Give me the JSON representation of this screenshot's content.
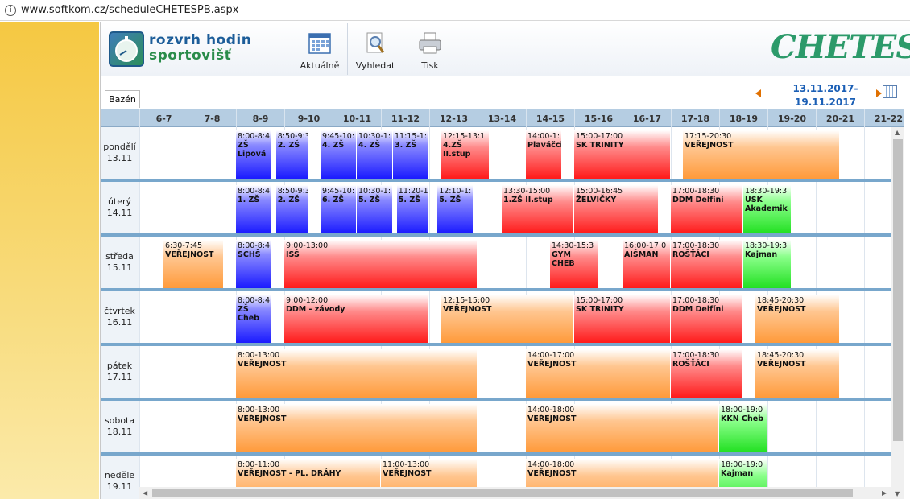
{
  "browser": {
    "url": "www.softkom.cz/scheduleCHETESPB.aspx"
  },
  "header": {
    "logo_line1": "rozvrh hodin",
    "logo_line2": "sportovišť",
    "tools": [
      {
        "label": "Aktuálně",
        "icon": "calendar-grid-icon"
      },
      {
        "label": "Vyhledat",
        "icon": "magnifier-icon"
      },
      {
        "label": "Tisk",
        "icon": "printer-icon"
      }
    ],
    "brand": "CHETES"
  },
  "tabs": [
    {
      "label": "Bazén",
      "active": true
    }
  ],
  "date_range": {
    "line1": "13.11.2017-",
    "line2": "19.11.2017"
  },
  "hours": [
    "6-7",
    "7-8",
    "8-9",
    "9-10",
    "10-11",
    "11-12",
    "12-13",
    "13-14",
    "14-15",
    "15-16",
    "16-17",
    "17-18",
    "18-19",
    "19-20",
    "20-21",
    "21-22"
  ],
  "days": [
    {
      "name": "pondělí",
      "date": "13.11",
      "events": [
        {
          "start": 8,
          "end": 8.75,
          "time": "8:00-8:4",
          "label": "ZŠ Lipová",
          "color": "blue"
        },
        {
          "start": 8.83,
          "end": 9.5,
          "time": "8:50-9:3",
          "label": "2. ZŠ",
          "color": "blue"
        },
        {
          "start": 9.75,
          "end": 10.5,
          "time": "9:45-10:",
          "label": "4. ZŠ",
          "color": "blue"
        },
        {
          "start": 10.5,
          "end": 11.25,
          "time": "10:30-1:",
          "label": "4. ZŠ",
          "color": "blue"
        },
        {
          "start": 11.25,
          "end": 12,
          "time": "11:15-1:",
          "label": "3. ZŠ",
          "color": "blue"
        },
        {
          "start": 12.25,
          "end": 13.25,
          "time": "12:15-13:1",
          "label": "4.ZŠ II.stup",
          "color": "red"
        },
        {
          "start": 14,
          "end": 14.75,
          "time": "14:00-1:",
          "label": "Plaváčci",
          "color": "red"
        },
        {
          "start": 15,
          "end": 17,
          "time": "15:00-17:00",
          "label": "SK TRINITY",
          "color": "red"
        },
        {
          "start": 17.25,
          "end": 20.5,
          "time": "17:15-20:30",
          "label": "VEŘEJNOST",
          "color": "orange"
        }
      ]
    },
    {
      "name": "úterý",
      "date": "14.11",
      "events": [
        {
          "start": 8,
          "end": 8.75,
          "time": "8:00-8:4",
          "label": "1. ZŠ",
          "color": "blue"
        },
        {
          "start": 8.83,
          "end": 9.5,
          "time": "8:50-9:3",
          "label": "2. ZŠ",
          "color": "blue"
        },
        {
          "start": 9.75,
          "end": 10.5,
          "time": "9:45-10:",
          "label": "6. ZŠ",
          "color": "blue"
        },
        {
          "start": 10.5,
          "end": 11.25,
          "time": "10:30-1:",
          "label": "5. ZŠ",
          "color": "blue"
        },
        {
          "start": 11.33,
          "end": 12,
          "time": "11:20-1:",
          "label": "5. ZŠ",
          "color": "blue"
        },
        {
          "start": 12.17,
          "end": 12.92,
          "time": "12:10-1:",
          "label": "5. ZŠ",
          "color": "blue"
        },
        {
          "start": 13.5,
          "end": 15,
          "time": "13:30-15:00",
          "label": "1.ZŠ II.stup",
          "color": "red"
        },
        {
          "start": 15,
          "end": 16.75,
          "time": "15:00-16:45",
          "label": "ŽELVIČKY",
          "color": "red"
        },
        {
          "start": 17,
          "end": 18.5,
          "time": "17:00-18:30",
          "label": "DDM Delfíni",
          "color": "red"
        },
        {
          "start": 18.5,
          "end": 19.5,
          "time": "18:30-19:3",
          "label": "USK Akademik",
          "color": "green"
        }
      ]
    },
    {
      "name": "středa",
      "date": "15.11",
      "events": [
        {
          "start": 6.5,
          "end": 7.75,
          "time": "6:30-7:45",
          "label": "VEŘEJNOST",
          "color": "orange"
        },
        {
          "start": 8,
          "end": 8.75,
          "time": "8:00-8:4",
          "label": "SCHŠ",
          "color": "blue"
        },
        {
          "start": 9,
          "end": 13,
          "time": "9:00-13:00",
          "label": "ISŠ",
          "color": "red"
        },
        {
          "start": 14.5,
          "end": 15.5,
          "time": "14:30-15:3",
          "label": "GYM CHEB",
          "color": "red"
        },
        {
          "start": 16,
          "end": 17,
          "time": "16:00-17:0",
          "label": "AIŠMAN",
          "color": "red"
        },
        {
          "start": 17,
          "end": 18.5,
          "time": "17:00-18:30",
          "label": "ROŠŤÁCI",
          "color": "red"
        },
        {
          "start": 18.5,
          "end": 19.5,
          "time": "18:30-19:3",
          "label": "Kajman",
          "color": "green"
        }
      ]
    },
    {
      "name": "čtvrtek",
      "date": "16.11",
      "events": [
        {
          "start": 8,
          "end": 8.75,
          "time": "8:00-8:4",
          "label": "ZŠ Cheb",
          "color": "blue"
        },
        {
          "start": 9,
          "end": 12,
          "time": "9:00-12:00",
          "label": "DDM - závody",
          "color": "red"
        },
        {
          "start": 12.25,
          "end": 15,
          "time": "12:15-15:00",
          "label": "VEŘEJNOST",
          "color": "orange"
        },
        {
          "start": 15,
          "end": 17,
          "time": "15:00-17:00",
          "label": "SK TRINITY",
          "color": "red"
        },
        {
          "start": 17,
          "end": 18.5,
          "time": "17:00-18:30",
          "label": "DDM Delfíni",
          "color": "red"
        },
        {
          "start": 18.75,
          "end": 20.5,
          "time": "18:45-20:30",
          "label": "VEŘEJNOST",
          "color": "orange"
        }
      ]
    },
    {
      "name": "pátek",
      "date": "17.11",
      "events": [
        {
          "start": 8,
          "end": 13,
          "time": "8:00-13:00",
          "label": "VEŘEJNOST",
          "color": "orange"
        },
        {
          "start": 14,
          "end": 17,
          "time": "14:00-17:00",
          "label": "VEŘEJNOST",
          "color": "orange"
        },
        {
          "start": 17,
          "end": 18.5,
          "time": "17:00-18:30",
          "label": "ROŠŤÁCI",
          "color": "red"
        },
        {
          "start": 18.75,
          "end": 20.5,
          "time": "18:45-20:30",
          "label": "VEŘEJNOST",
          "color": "orange"
        }
      ]
    },
    {
      "name": "sobota",
      "date": "18.11",
      "events": [
        {
          "start": 8,
          "end": 13,
          "time": "8:00-13:00",
          "label": "VEŘEJNOST",
          "color": "orange"
        },
        {
          "start": 14,
          "end": 18,
          "time": "14:00-18:00",
          "label": "VEŘEJNOST",
          "color": "orange"
        },
        {
          "start": 18,
          "end": 19,
          "time": "18:00-19:0",
          "label": "KKN Cheb",
          "color": "green"
        }
      ]
    },
    {
      "name": "neděle",
      "date": "19.11",
      "events": [
        {
          "start": 8,
          "end": 11,
          "time": "8:00-11:00",
          "label": "VEŘEJNOST - PL. DRÁHY",
          "color": "orange"
        },
        {
          "start": 11,
          "end": 13,
          "time": "11:00-13:00",
          "label": "VEŘEJNOST",
          "color": "orange"
        },
        {
          "start": 14,
          "end": 18,
          "time": "14:00-18:00",
          "label": "VEŘEJNOST",
          "color": "orange"
        },
        {
          "start": 18,
          "end": 19,
          "time": "18:00-19:0",
          "label": "Kajman",
          "color": "green"
        }
      ]
    }
  ]
}
